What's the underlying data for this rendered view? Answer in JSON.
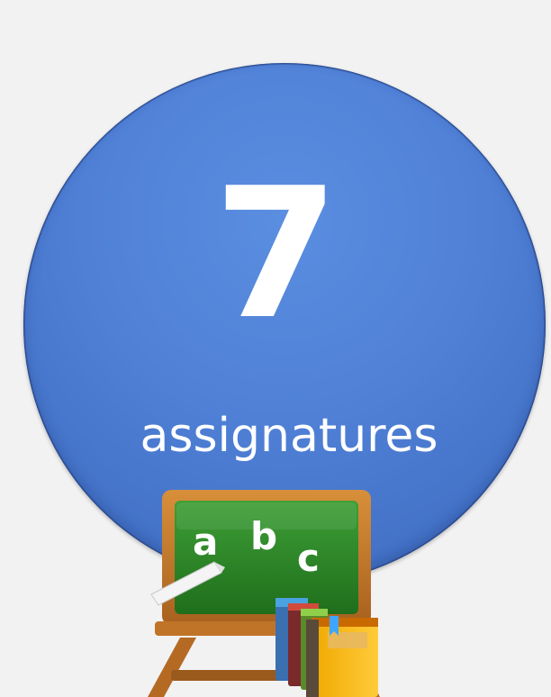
{
  "badge": {
    "count": "7",
    "label": "assignatures"
  },
  "chalkboard": {
    "letters": [
      "a",
      "b",
      "c"
    ]
  },
  "colors": {
    "background": "#f2f2f2",
    "circle": "#4f80d6",
    "text": "#ffffff",
    "board": "#2e8b2a",
    "frame": "#c47a2c"
  },
  "icons": [
    "chalkboard-icon",
    "books-icon",
    "chalk-icon"
  ]
}
